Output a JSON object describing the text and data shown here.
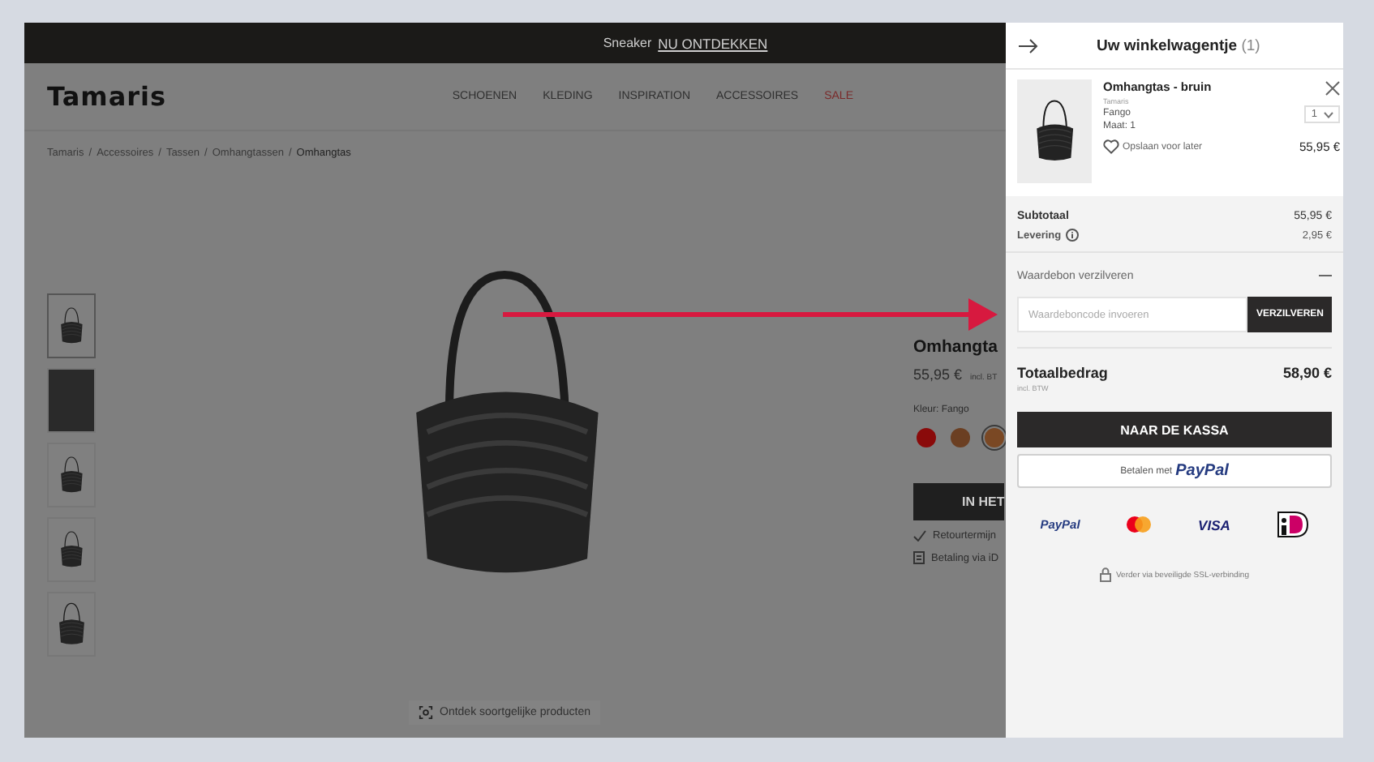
{
  "promo_bar": {
    "text": "Sneaker",
    "link": "NU ONTDEKKEN"
  },
  "header": {
    "logo": "Tamaris",
    "nav": [
      {
        "label": "SCHOENEN",
        "kind": "normal"
      },
      {
        "label": "KLEDING",
        "kind": "normal"
      },
      {
        "label": "INSPIRATION",
        "kind": "normal"
      },
      {
        "label": "ACCESSOIRES",
        "kind": "normal"
      },
      {
        "label": "SALE",
        "kind": "sale"
      }
    ]
  },
  "breadcrumb": {
    "separator": "/",
    "items": [
      "Tamaris",
      "Accessoires",
      "Tassen",
      "Omhangtassen",
      "Omhangtas"
    ]
  },
  "gallery": {
    "thumbnails": [
      {
        "kind": "front",
        "selected": true
      },
      {
        "kind": "detail",
        "selected": false
      },
      {
        "kind": "front",
        "selected": false
      },
      {
        "kind": "front",
        "selected": false
      },
      {
        "kind": "side",
        "selected": false
      }
    ],
    "similar_button": "Ontdek soortgelijke producten"
  },
  "product": {
    "title": "Omhangta",
    "price": "55,95 €",
    "tax_note": "incl. BT",
    "color_label": "Kleur: Fango",
    "colors": [
      {
        "color": "#8a0a0a",
        "selected": false
      },
      {
        "color": "#6b3f22",
        "selected": false
      },
      {
        "color": "#7a4824",
        "selected": true
      }
    ],
    "cart_button": "IN HET",
    "benefits": [
      {
        "kind": "check",
        "text": "Retourtermijn"
      },
      {
        "kind": "document",
        "text": "Betaling via iD"
      }
    ]
  },
  "cart": {
    "title": "Uw winkelwagentje",
    "count": "(1)",
    "items": [
      {
        "name": "Omhangtas - bruin",
        "brand": "Tamaris",
        "variant": "Fango",
        "size": "Maat: 1",
        "quantity": "1",
        "save_later": "Opslaan voor later",
        "price": "55,95 €"
      }
    ],
    "subtotal": {
      "label": "Subtotaal",
      "value": "55,95 €"
    },
    "delivery": {
      "label": "Levering",
      "value": "2,95 €"
    },
    "voucher": {
      "title": "Waardebon verzilveren",
      "expanded": true,
      "placeholder": "Waardeboncode invoeren",
      "button": "VERZILVEREN"
    },
    "total": {
      "label": "Totaalbedrag",
      "value": "58,90 €",
      "tax_note": "incl. BTW"
    },
    "checkout_button": "NAAR DE KASSA",
    "paypal_button": {
      "text": "Betalen met",
      "logo": "PayPal"
    },
    "payment_methods": [
      {
        "kind": "paypal",
        "label": "PayPal"
      },
      {
        "kind": "mastercard"
      },
      {
        "kind": "visa",
        "label": "VISA"
      },
      {
        "kind": "ideal"
      }
    ],
    "secure_note": "Verder via beveiligde SSL-verbinding"
  }
}
